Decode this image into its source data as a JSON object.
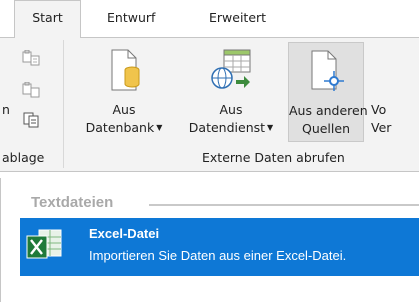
{
  "tabs": [
    {
      "label": "Start",
      "active": true
    },
    {
      "label": "Entwurf",
      "active": false
    },
    {
      "label": "Erweitert",
      "active": false
    }
  ],
  "ribbon": {
    "clipboard_group": {
      "partial_label": "ablage",
      "partial_left_label": "n"
    },
    "external_data_group": {
      "label": "Externe Daten abrufen",
      "buttons": [
        {
          "line1": "Aus",
          "line2": "Datenbank",
          "has_dropdown": true,
          "icon": "database-document-icon"
        },
        {
          "line1": "Aus",
          "line2": "Datendienst",
          "has_dropdown": true,
          "icon": "data-service-icon"
        },
        {
          "line1": "Aus anderen",
          "line2": "Quellen",
          "has_dropdown": false,
          "icon": "other-sources-icon",
          "hovered": true
        }
      ],
      "partial_button": {
        "line1": "Vo",
        "line2": "Ver"
      }
    }
  },
  "panel": {
    "section_title": "Textdateien",
    "selected_item": {
      "title": "Excel-Datei",
      "description": "Importieren Sie Daten aus einer Excel-Datei.",
      "icon": "excel-file-icon"
    }
  },
  "colors": {
    "accent": "#0e78d6",
    "ribbon_bg": "#f3f3f3",
    "section_head": "#a9a9a9"
  }
}
